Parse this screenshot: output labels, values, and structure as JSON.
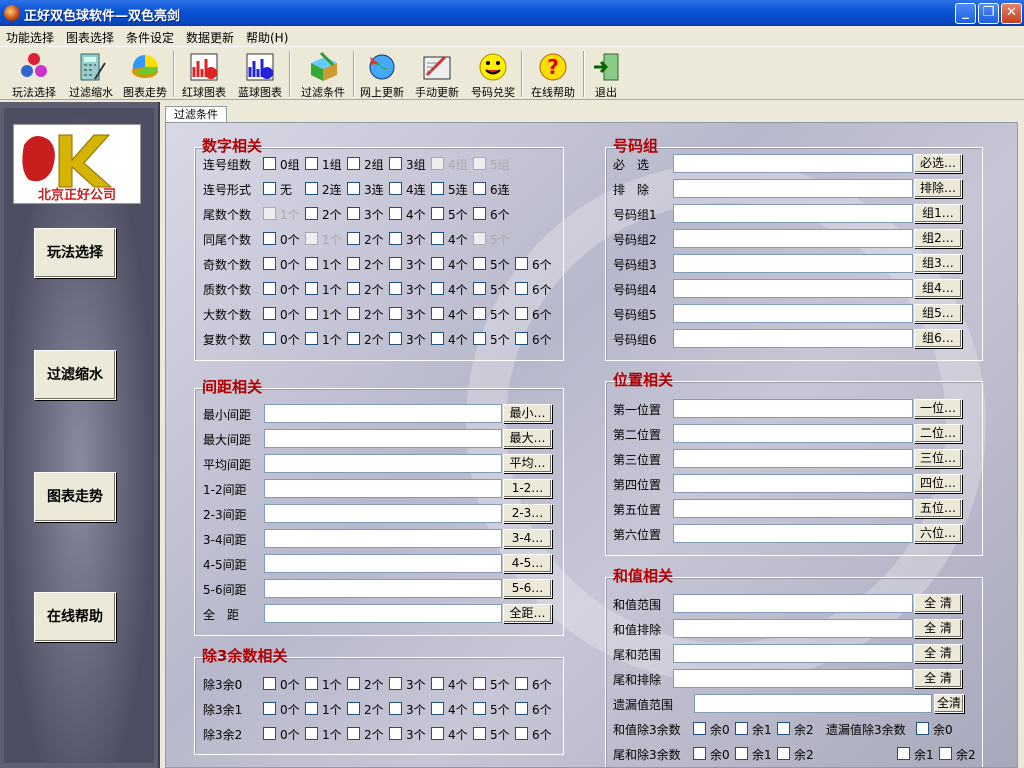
{
  "window": {
    "title": "正好双色球软件—双色亮剑"
  },
  "menu": [
    "功能选择",
    "图表选择",
    "条件设定",
    "数据更新",
    "帮助(H)"
  ],
  "toolbar": [
    {
      "label": "玩法选择",
      "icon": "balls-icon"
    },
    {
      "label": "过滤缩水",
      "icon": "calculator-icon"
    },
    {
      "label": "图表走势",
      "icon": "pie-chart-icon"
    },
    {
      "label": "红球图表",
      "icon": "red-chart-icon"
    },
    {
      "label": "蓝球图表",
      "icon": "blue-chart-icon"
    },
    {
      "label": "过滤条件",
      "icon": "filter-box-icon"
    },
    {
      "label": "网上更新",
      "icon": "globe-icon"
    },
    {
      "label": "手动更新",
      "icon": "edit-icon"
    },
    {
      "label": "号码兑奖",
      "icon": "smiley-icon"
    },
    {
      "label": "在线帮助",
      "icon": "help-icon"
    },
    {
      "label": "退出",
      "icon": "exit-icon"
    }
  ],
  "logo": {
    "text": "北京正好公司",
    "mark": "K"
  },
  "left_buttons": [
    "玩法选择",
    "过滤缩水",
    "图表走势",
    "在线帮助"
  ],
  "tab": "过滤条件",
  "digits": {
    "title": "数字相关",
    "rows": [
      {
        "label": "连号组数",
        "opts": [
          "0组",
          "1组",
          "2组",
          "3组",
          "4组",
          "5组"
        ],
        "dis": [
          4,
          5
        ]
      },
      {
        "label": "连号形式",
        "opts": [
          "无",
          "2连",
          "3连",
          "4连",
          "5连",
          "6连"
        ],
        "dis": []
      },
      {
        "label": "尾数个数",
        "opts": [
          "1个",
          "2个",
          "3个",
          "4个",
          "5个",
          "6个"
        ],
        "dis": [
          0
        ]
      },
      {
        "label": "同尾个数",
        "opts": [
          "0个",
          "1个",
          "2个",
          "3个",
          "4个",
          "5个"
        ],
        "dis": [
          1,
          5
        ]
      },
      {
        "label": "奇数个数",
        "opts": [
          "0个",
          "1个",
          "2个",
          "3个",
          "4个",
          "5个",
          "6个"
        ],
        "dis": []
      },
      {
        "label": "质数个数",
        "opts": [
          "0个",
          "1个",
          "2个",
          "3个",
          "4个",
          "5个",
          "6个"
        ],
        "dis": []
      },
      {
        "label": "大数个数",
        "opts": [
          "0个",
          "1个",
          "2个",
          "3个",
          "4个",
          "5个",
          "6个"
        ],
        "dis": []
      },
      {
        "label": "复数个数",
        "opts": [
          "0个",
          "1个",
          "2个",
          "3个",
          "4个",
          "5个",
          "6个"
        ],
        "dis": []
      }
    ]
  },
  "spacing": {
    "title": "间距相关",
    "rows": [
      {
        "label": "最小间距",
        "btn": "最小…"
      },
      {
        "label": "最大间距",
        "btn": "最大…"
      },
      {
        "label": "平均间距",
        "btn": "平均…"
      },
      {
        "label": "1-2间距",
        "btn": "1-2…"
      },
      {
        "label": "2-3间距",
        "btn": "2-3…"
      },
      {
        "label": "3-4间距",
        "btn": "3-4…"
      },
      {
        "label": "4-5间距",
        "btn": "4-5…"
      },
      {
        "label": "5-6间距",
        "btn": "5-6…"
      },
      {
        "label": "全　距",
        "btn": "全距…"
      }
    ]
  },
  "mod3": {
    "title": "除3余数相关",
    "rows": [
      {
        "label": "除3余0",
        "opts": [
          "0个",
          "1个",
          "2个",
          "3个",
          "4个",
          "5个",
          "6个"
        ]
      },
      {
        "label": "除3余1",
        "opts": [
          "0个",
          "1个",
          "2个",
          "3个",
          "4个",
          "5个",
          "6个"
        ]
      },
      {
        "label": "除3余2",
        "opts": [
          "0个",
          "1个",
          "2个",
          "3个",
          "4个",
          "5个",
          "6个"
        ]
      }
    ]
  },
  "numgroup": {
    "title": "号码组",
    "rows": [
      {
        "label": "必　选",
        "btn": "必选…"
      },
      {
        "label": "排　除",
        "btn": "排除…"
      },
      {
        "label": "号码组1",
        "btn": "组1…"
      },
      {
        "label": "号码组2",
        "btn": "组2…"
      },
      {
        "label": "号码组3",
        "btn": "组3…"
      },
      {
        "label": "号码组4",
        "btn": "组4…"
      },
      {
        "label": "号码组5",
        "btn": "组5…"
      },
      {
        "label": "号码组6",
        "btn": "组6…"
      }
    ]
  },
  "position": {
    "title": "位置相关",
    "rows": [
      {
        "label": "第一位置",
        "btn": "一位…"
      },
      {
        "label": "第二位置",
        "btn": "二位…"
      },
      {
        "label": "第三位置",
        "btn": "三位…"
      },
      {
        "label": "第四位置",
        "btn": "四位…"
      },
      {
        "label": "第五位置",
        "btn": "五位…"
      },
      {
        "label": "第六位置",
        "btn": "六位…"
      }
    ]
  },
  "sum": {
    "title": "和值相关",
    "rows": [
      {
        "label": "和值范围",
        "btn": "全 清"
      },
      {
        "label": "和值排除",
        "btn": "全 清"
      },
      {
        "label": "尾和范围",
        "btn": "全 清"
      },
      {
        "label": "尾和排除",
        "btn": "全 清"
      }
    ],
    "missing": {
      "label": "遗漏值范围",
      "btn": "全清"
    },
    "mod_rows": [
      {
        "label": "和值除3余数",
        "opts": [
          "余0",
          "余1",
          "余2"
        ]
      },
      {
        "label": "尾和除3余数",
        "opts": [
          "余0",
          "余1",
          "余2"
        ]
      }
    ],
    "missing_mod": {
      "label": "遗漏值除3余数",
      "opts": [
        "余0",
        "余1",
        "余2"
      ]
    }
  }
}
